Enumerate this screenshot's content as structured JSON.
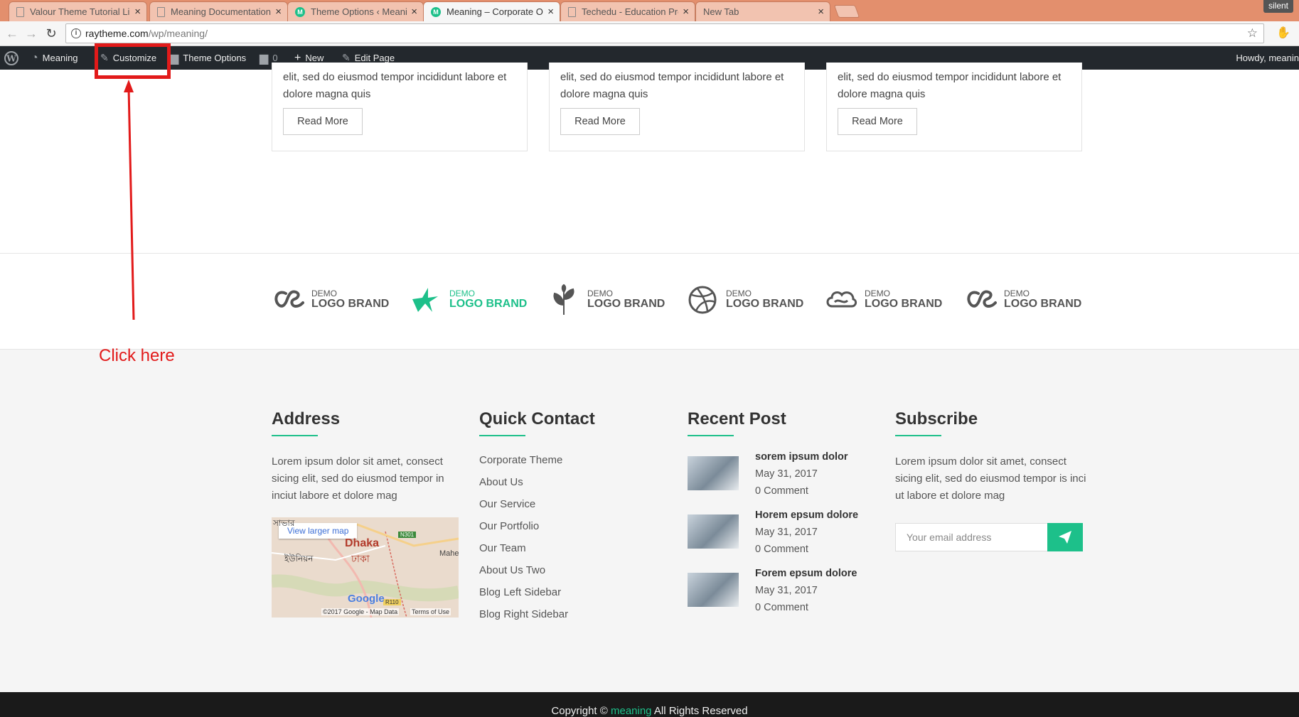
{
  "browser": {
    "tabs": [
      {
        "label": "Valour Theme Tutorial Li",
        "icon": "page-icon"
      },
      {
        "label": "Meaning Documentation",
        "icon": "page-icon"
      },
      {
        "label": "Theme Options ‹ Meanin",
        "icon": "meaning-favicon"
      },
      {
        "label": "Meaning – Corporate On",
        "icon": "meaning-favicon",
        "active": true
      },
      {
        "label": "Techedu - Education Pre",
        "icon": "page-icon"
      },
      {
        "label": "New Tab",
        "icon": ""
      }
    ],
    "profile_label": "silent",
    "url_host": "raytheme.com",
    "url_path": "/wp/meaning/"
  },
  "admin_bar": {
    "site_name": "Meaning",
    "customize": "Customize",
    "theme_options": "Theme Options",
    "comments_count": "0",
    "new": "New",
    "edit_page": "Edit Page",
    "howdy": "Howdy, meanin"
  },
  "cards": [
    {
      "text": "elit, sed do eiusmod tempor incididunt labore et dolore magna  quis",
      "button": "Read More"
    },
    {
      "text": "elit, sed do eiusmod tempor incididunt labore et dolore magna quis",
      "button": "Read More"
    },
    {
      "text": "elit, sed do eiusmod tempor incididunt labore et dolore magna  quis",
      "button": "Read More"
    }
  ],
  "brands": [
    {
      "demo": "DEMO",
      "name": "LOGO BRAND",
      "icon": "lastfm-icon"
    },
    {
      "demo": "DEMO",
      "name": "LOGO BRAND",
      "icon": "bird-icon",
      "highlight": true
    },
    {
      "demo": "DEMO",
      "name": "LOGO BRAND",
      "icon": "leaf-icon"
    },
    {
      "demo": "DEMO",
      "name": "LOGO BRAND",
      "icon": "dribbble-icon"
    },
    {
      "demo": "DEMO",
      "name": "LOGO BRAND",
      "icon": "cloud-icon"
    },
    {
      "demo": "DEMO",
      "name": "LOGO BRAND",
      "icon": "lastfm-icon"
    }
  ],
  "annotation": {
    "text": "Click here",
    "color": "#e21a1a"
  },
  "footer": {
    "address": {
      "title": "Address",
      "text": "Lorem ipsum dolor sit amet, consect sicing elit, sed do eiusmod tempor in inciut labore et dolore mag",
      "map_link": "View larger map",
      "map_city": "Dhaka",
      "map_city_local": "ঢাকা",
      "map_label_local": "সাভার",
      "map_label_local2": "ইউনিয়ন",
      "map_label_mahe": "Mahe",
      "map_road1": "N301",
      "map_road2": "R110",
      "map_logo": "Google",
      "map_credit": "©2017 Google - Map Data",
      "map_terms": "Terms of Use"
    },
    "quick_contact": {
      "title": "Quick Contact",
      "links": [
        "Corporate Theme",
        "About Us",
        "Our Service",
        "Our Portfolio",
        "Our Team",
        "About Us Two",
        "Blog Left Sidebar",
        "Blog Right Sidebar"
      ]
    },
    "recent_post": {
      "title": "Recent Post",
      "posts": [
        {
          "title": "sorem ipsum dolor",
          "date": "May 31, 2017",
          "comments": "0 Comment"
        },
        {
          "title": "Horem epsum dolore",
          "date": "May 31, 2017",
          "comments": "0 Comment"
        },
        {
          "title": "Forem epsum dolore",
          "date": "May 31, 2017",
          "comments": "0 Comment"
        }
      ]
    },
    "subscribe": {
      "title": "Subscribe",
      "text": "Lorem ipsum dolor sit amet, consect sicing elit, sed do eiusmod tempor is inci ut labore et dolore mag",
      "placeholder": "Your email address"
    },
    "copyright_pre": "Copyright ©",
    "copyright_brand": "meaning",
    "copyright_post": " All Rights Reserved"
  },
  "colors": {
    "accent": "#1dc08a",
    "annotation": "#e21a1a",
    "admin_bar": "#23282d",
    "tabbar": "#e38f6d"
  }
}
